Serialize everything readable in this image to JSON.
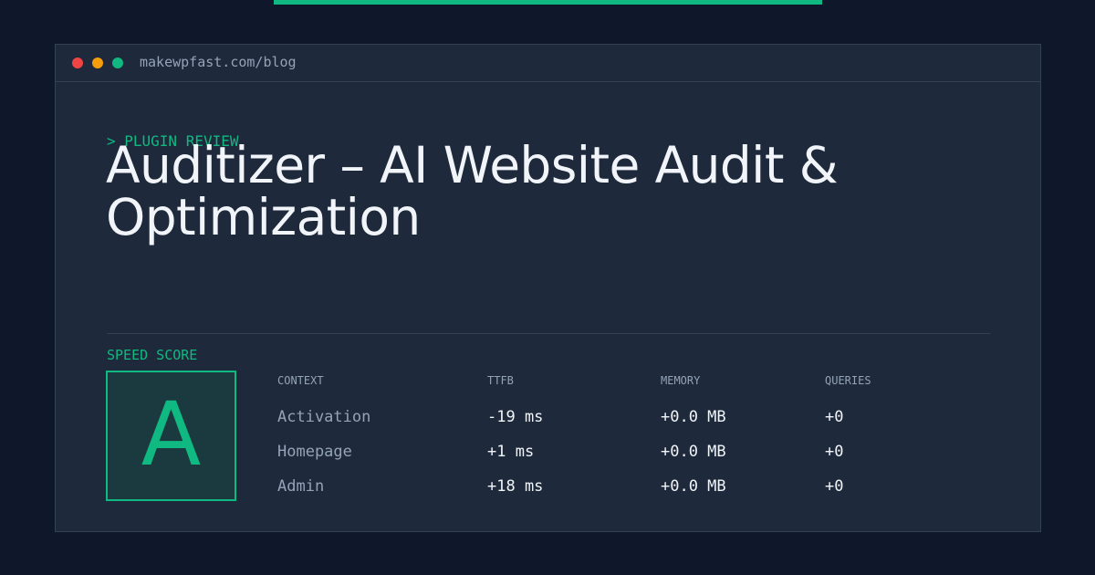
{
  "accent_color": "#10b981",
  "window": {
    "url": "makewpfast.com/blog",
    "controls": [
      "close",
      "minimize",
      "maximize"
    ]
  },
  "post": {
    "kicker": "> PLUGIN REVIEW",
    "title": "Auditizer – AI Website Audit & Optimization"
  },
  "score": {
    "label": "SPEED SCORE",
    "grade": "A"
  },
  "table": {
    "headers": [
      "CONTEXT",
      "TTFB",
      "MEMORY",
      "QUERIES"
    ],
    "rows": [
      [
        "Activation",
        "-19 ms",
        "+0.0 MB",
        "+0"
      ],
      [
        "Homepage",
        "+1 ms",
        "+0.0 MB",
        "+0"
      ],
      [
        "Admin",
        "+18 ms",
        "+0.0 MB",
        "+0"
      ]
    ]
  }
}
